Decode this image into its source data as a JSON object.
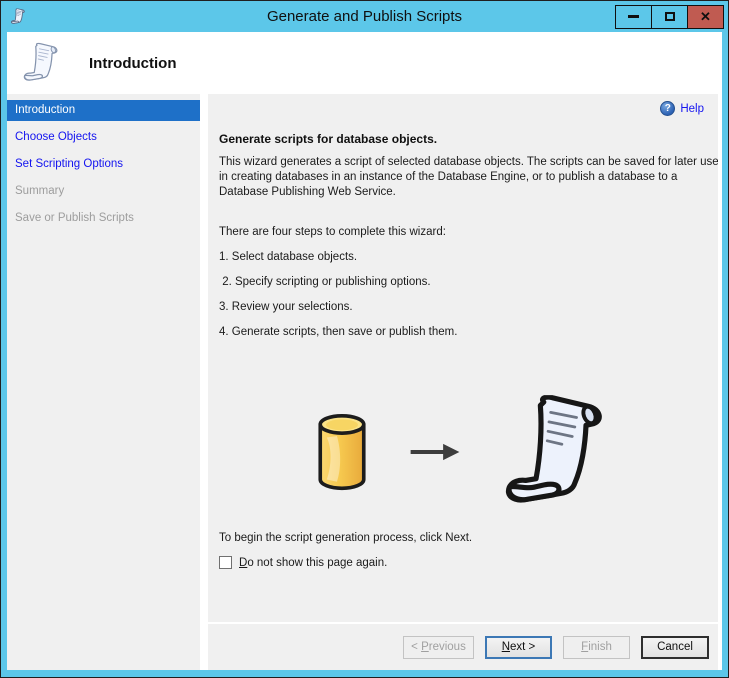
{
  "window": {
    "title": "Generate and Publish Scripts",
    "close_glyph": "✕"
  },
  "header": {
    "title": "Introduction"
  },
  "sidebar": {
    "items": [
      {
        "label": "Introduction",
        "state": "active"
      },
      {
        "label": "Choose Objects",
        "state": "link"
      },
      {
        "label": "Set Scripting Options",
        "state": "link"
      },
      {
        "label": "Summary",
        "state": "disabled"
      },
      {
        "label": "Save or Publish Scripts",
        "state": "disabled"
      }
    ]
  },
  "content": {
    "help_label": "Help",
    "help_icon_glyph": "?",
    "heading": "Generate scripts for database objects.",
    "intro_paragraph": "This wizard generates a script of selected database objects. The scripts can be saved for later use in creating databases in an instance of the Database Engine, or to publish a database to a Database Publishing Web Service.",
    "steps_intro": "There are four steps to complete this wizard:",
    "steps": [
      "1. Select database objects.",
      " 2. Specify scripting or publishing options.",
      "3. Review your selections.",
      "4. Generate scripts, then save or publish them."
    ],
    "instruction": "To begin the script generation process, click Next.",
    "checkbox_label": "_D_o not show this page again.",
    "checkbox_checked": false
  },
  "footer": {
    "previous_label": "< _P_revious",
    "next_label": "_N_ext >",
    "finish_label": "_F_inish",
    "cancel_label": "Cancel"
  },
  "colors": {
    "titlebar_blue": "#5cc7e9",
    "close_red": "#c05b51",
    "selected_blue": "#1e70c8",
    "link_blue": "#1414f0",
    "disabled_gray": "#9d9d9d",
    "panel_gray": "#f0f0f0"
  }
}
